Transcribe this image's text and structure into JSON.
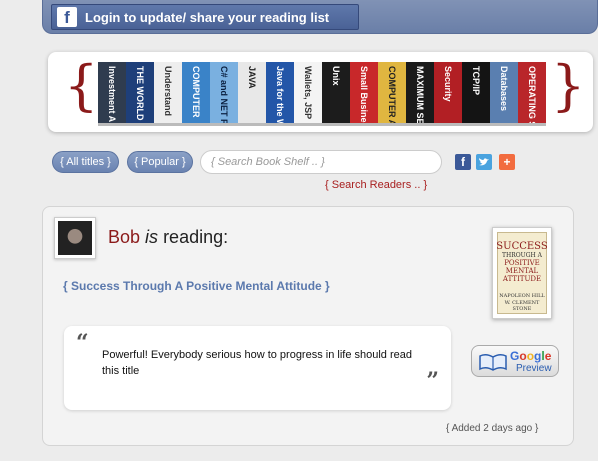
{
  "topbar": {
    "login_label": "Login to update/ share your reading list",
    "fb_logo": "f"
  },
  "banner": {
    "brace_left": "{",
    "brace_right": "}",
    "spines": [
      {
        "text": "Investment A",
        "bg": "#2f3c4f",
        "fg": "#ffffff"
      },
      {
        "text": "THE WORLD E",
        "bg": "#1e3f7a",
        "fg": "#ffffff"
      },
      {
        "text": "Understand",
        "bg": "#eeeeee",
        "fg": "#333333"
      },
      {
        "text": "COMPUTER",
        "bg": "#3a83c8",
        "fg": "#ffffff"
      },
      {
        "text": "C# and NET Fr",
        "bg": "#7ab0e0",
        "fg": "#0b2040"
      },
      {
        "text": "JAVA",
        "bg": "#e8e8e8",
        "fg": "#222222"
      },
      {
        "text": "Java for the Web",
        "bg": "#2356a8",
        "fg": "#ffffff"
      },
      {
        "text": "Wallets, JSP",
        "bg": "#f4f4f4",
        "fg": "#333333"
      },
      {
        "text": "Unix",
        "bg": "#1c1c1c",
        "fg": "#ffffff"
      },
      {
        "text": "Small Business",
        "bg": "#c8282a",
        "fg": "#ffffff"
      },
      {
        "text": "COMPUTER AR",
        "bg": "#e0b640",
        "fg": "#222222"
      },
      {
        "text": "MAXIMUM SEC",
        "bg": "#1a1a1a",
        "fg": "#ffffff"
      },
      {
        "text": "Security",
        "bg": "#b21f24",
        "fg": "#ffffff"
      },
      {
        "text": "TCP/IP",
        "bg": "#141414",
        "fg": "#ffffff"
      },
      {
        "text": "Databases",
        "bg": "#5a7fb0",
        "fg": "#ffffff"
      },
      {
        "text": "OPERATING SYS",
        "bg": "#b9262a",
        "fg": "#ffffff"
      }
    ]
  },
  "nav": {
    "all_titles": "{ All titles }",
    "popular": "{ Popular }",
    "search_placeholder": "{ Search Book Shelf .. }",
    "search_readers": "{ Search Readers .. }",
    "share_icons": [
      "facebook-icon",
      "twitter-icon",
      "addthis-icon"
    ]
  },
  "entry": {
    "reader": "Bob",
    "is": "is",
    "reading": "reading:",
    "book_title": "{ Success Through A Positive Mental Attitude }",
    "cover": {
      "line1": "SUCCESS",
      "line2": "THROUGH A",
      "line3": "POSITIVE",
      "line4": "MENTAL",
      "line5": "ATTITUDE",
      "author1": "NAPOLEON HILL",
      "author2": "W. CLEMENT STONE"
    },
    "quote_open": "“",
    "quote_close": "”",
    "comment": "Powerful! Everybody serious how to progress in life should read this title",
    "google_label": "Google",
    "preview_label": "Preview",
    "added": "{ Added 2 days ago }"
  }
}
